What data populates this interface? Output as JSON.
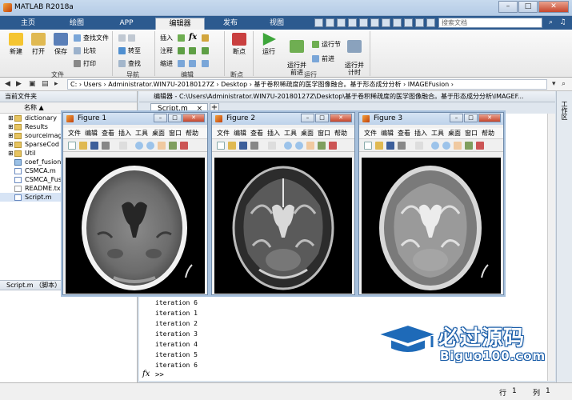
{
  "window": {
    "title": "MATLAB R2018a",
    "min": "–",
    "max": "□",
    "close": "✕"
  },
  "tabs": [
    {
      "label": "主页"
    },
    {
      "label": "绘图"
    },
    {
      "label": "APP"
    },
    {
      "label": "编辑器"
    },
    {
      "label": "发布"
    },
    {
      "label": "视图"
    }
  ],
  "search": {
    "placeholder": "搜索文档"
  },
  "ribbon": {
    "file": {
      "new": "新建",
      "open": "打开",
      "save": "保存",
      "find_files": "查找文件",
      "compare": "比较",
      "print": "打印",
      "group": "文件"
    },
    "navigate": {
      "goto": "转至",
      "find": "查找",
      "group": "导航"
    },
    "edit": {
      "insert": "插入",
      "fx": "fx",
      "comment": "注释",
      "indent": "缩进",
      "group": "编辑"
    },
    "breakpoints": {
      "label": "断点",
      "group": "断点"
    },
    "run": {
      "run": "运行",
      "run_advance": "运行并\n前进",
      "run_section": "运行节",
      "advance": "前进",
      "run_time": "运行并\n计时",
      "group": "运行"
    }
  },
  "address": {
    "path": "C:  ›  Users  ›  Administrator.WIN7U-20180127Z  ›  Desktop  ›  基于卷积稀疏度的医学图像融合。基于形态成分分析  ›  IMAGEFusion  ›"
  },
  "current_folder": {
    "header": "当前文件夹",
    "column": "名称 ▲",
    "items": [
      {
        "name": "dictionary",
        "type": "folder"
      },
      {
        "name": "Results",
        "type": "folder"
      },
      {
        "name": "sourceimag",
        "type": "folder"
      },
      {
        "name": "SparseCod",
        "type": "folder"
      },
      {
        "name": "Util",
        "type": "folder"
      },
      {
        "name": "coef_fusion",
        "type": "mat"
      },
      {
        "name": "CSMCA.m",
        "type": "m"
      },
      {
        "name": "CSMCA_Fus",
        "type": "m"
      },
      {
        "name": "README.tx",
        "type": "txt"
      },
      {
        "name": "Script.m",
        "type": "m"
      }
    ],
    "detail": "Script.m  （脚本）"
  },
  "editor": {
    "header": "编辑器 - C:\\Users\\Administrator.WIN7U-20180127Z\\Desktop\\基于卷积稀疏度的医学图像融合。基于形态成分分析\\IMAGEF...",
    "tab": "Script.m",
    "close_x": "×",
    "plus": "+"
  },
  "command_window": {
    "lines": [
      "iteration 6",
      "iteration 1",
      "iteration 2",
      "iteration 3",
      "iteration 4",
      "iteration 5",
      "iteration 6"
    ],
    "fx": "fx",
    "prompt": ">>"
  },
  "figures": [
    {
      "title": "Figure 1"
    },
    {
      "title": "Figure 2"
    },
    {
      "title": "Figure 3"
    }
  ],
  "figure_menu": [
    "文件",
    "编辑",
    "查看",
    "插入",
    "工具",
    "桌面",
    "窗口",
    "帮助"
  ],
  "side_strip": {
    "label": "工作区"
  },
  "status": {
    "line_label": "行",
    "line": "1",
    "col_label": "列",
    "col": "1"
  },
  "watermark": {
    "cn": "必过源码",
    "en": "Biguo100.com"
  }
}
